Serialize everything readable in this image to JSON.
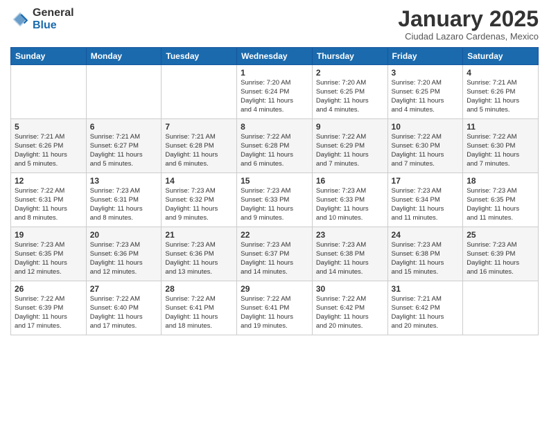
{
  "logo": {
    "general": "General",
    "blue": "Blue"
  },
  "header": {
    "month": "January 2025",
    "location": "Ciudad Lazaro Cardenas, Mexico"
  },
  "weekdays": [
    "Sunday",
    "Monday",
    "Tuesday",
    "Wednesday",
    "Thursday",
    "Friday",
    "Saturday"
  ],
  "weeks": [
    [
      {
        "day": "",
        "info": ""
      },
      {
        "day": "",
        "info": ""
      },
      {
        "day": "",
        "info": ""
      },
      {
        "day": "1",
        "info": "Sunrise: 7:20 AM\nSunset: 6:24 PM\nDaylight: 11 hours\nand 4 minutes."
      },
      {
        "day": "2",
        "info": "Sunrise: 7:20 AM\nSunset: 6:25 PM\nDaylight: 11 hours\nand 4 minutes."
      },
      {
        "day": "3",
        "info": "Sunrise: 7:20 AM\nSunset: 6:25 PM\nDaylight: 11 hours\nand 4 minutes."
      },
      {
        "day": "4",
        "info": "Sunrise: 7:21 AM\nSunset: 6:26 PM\nDaylight: 11 hours\nand 5 minutes."
      }
    ],
    [
      {
        "day": "5",
        "info": "Sunrise: 7:21 AM\nSunset: 6:26 PM\nDaylight: 11 hours\nand 5 minutes."
      },
      {
        "day": "6",
        "info": "Sunrise: 7:21 AM\nSunset: 6:27 PM\nDaylight: 11 hours\nand 5 minutes."
      },
      {
        "day": "7",
        "info": "Sunrise: 7:21 AM\nSunset: 6:28 PM\nDaylight: 11 hours\nand 6 minutes."
      },
      {
        "day": "8",
        "info": "Sunrise: 7:22 AM\nSunset: 6:28 PM\nDaylight: 11 hours\nand 6 minutes."
      },
      {
        "day": "9",
        "info": "Sunrise: 7:22 AM\nSunset: 6:29 PM\nDaylight: 11 hours\nand 7 minutes."
      },
      {
        "day": "10",
        "info": "Sunrise: 7:22 AM\nSunset: 6:30 PM\nDaylight: 11 hours\nand 7 minutes."
      },
      {
        "day": "11",
        "info": "Sunrise: 7:22 AM\nSunset: 6:30 PM\nDaylight: 11 hours\nand 7 minutes."
      }
    ],
    [
      {
        "day": "12",
        "info": "Sunrise: 7:22 AM\nSunset: 6:31 PM\nDaylight: 11 hours\nand 8 minutes."
      },
      {
        "day": "13",
        "info": "Sunrise: 7:23 AM\nSunset: 6:31 PM\nDaylight: 11 hours\nand 8 minutes."
      },
      {
        "day": "14",
        "info": "Sunrise: 7:23 AM\nSunset: 6:32 PM\nDaylight: 11 hours\nand 9 minutes."
      },
      {
        "day": "15",
        "info": "Sunrise: 7:23 AM\nSunset: 6:33 PM\nDaylight: 11 hours\nand 9 minutes."
      },
      {
        "day": "16",
        "info": "Sunrise: 7:23 AM\nSunset: 6:33 PM\nDaylight: 11 hours\nand 10 minutes."
      },
      {
        "day": "17",
        "info": "Sunrise: 7:23 AM\nSunset: 6:34 PM\nDaylight: 11 hours\nand 11 minutes."
      },
      {
        "day": "18",
        "info": "Sunrise: 7:23 AM\nSunset: 6:35 PM\nDaylight: 11 hours\nand 11 minutes."
      }
    ],
    [
      {
        "day": "19",
        "info": "Sunrise: 7:23 AM\nSunset: 6:35 PM\nDaylight: 11 hours\nand 12 minutes."
      },
      {
        "day": "20",
        "info": "Sunrise: 7:23 AM\nSunset: 6:36 PM\nDaylight: 11 hours\nand 12 minutes."
      },
      {
        "day": "21",
        "info": "Sunrise: 7:23 AM\nSunset: 6:36 PM\nDaylight: 11 hours\nand 13 minutes."
      },
      {
        "day": "22",
        "info": "Sunrise: 7:23 AM\nSunset: 6:37 PM\nDaylight: 11 hours\nand 14 minutes."
      },
      {
        "day": "23",
        "info": "Sunrise: 7:23 AM\nSunset: 6:38 PM\nDaylight: 11 hours\nand 14 minutes."
      },
      {
        "day": "24",
        "info": "Sunrise: 7:23 AM\nSunset: 6:38 PM\nDaylight: 11 hours\nand 15 minutes."
      },
      {
        "day": "25",
        "info": "Sunrise: 7:23 AM\nSunset: 6:39 PM\nDaylight: 11 hours\nand 16 minutes."
      }
    ],
    [
      {
        "day": "26",
        "info": "Sunrise: 7:22 AM\nSunset: 6:39 PM\nDaylight: 11 hours\nand 17 minutes."
      },
      {
        "day": "27",
        "info": "Sunrise: 7:22 AM\nSunset: 6:40 PM\nDaylight: 11 hours\nand 17 minutes."
      },
      {
        "day": "28",
        "info": "Sunrise: 7:22 AM\nSunset: 6:41 PM\nDaylight: 11 hours\nand 18 minutes."
      },
      {
        "day": "29",
        "info": "Sunrise: 7:22 AM\nSunset: 6:41 PM\nDaylight: 11 hours\nand 19 minutes."
      },
      {
        "day": "30",
        "info": "Sunrise: 7:22 AM\nSunset: 6:42 PM\nDaylight: 11 hours\nand 20 minutes."
      },
      {
        "day": "31",
        "info": "Sunrise: 7:21 AM\nSunset: 6:42 PM\nDaylight: 11 hours\nand 20 minutes."
      },
      {
        "day": "",
        "info": ""
      }
    ]
  ]
}
